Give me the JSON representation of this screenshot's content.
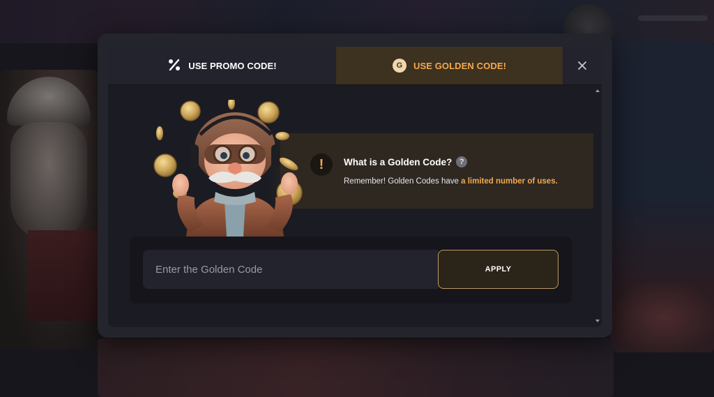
{
  "tabs": {
    "promo_label": "USE PROMO CODE!",
    "golden_label": "USE GOLDEN CODE!",
    "golden_icon_letter": "G",
    "active": "golden"
  },
  "info": {
    "title": "What is a Golden Code?",
    "help_symbol": "?",
    "warning_symbol": "!",
    "text_prefix": "Remember! Golden Codes have ",
    "text_highlight": "a limited number of uses."
  },
  "form": {
    "placeholder": "Enter the Golden Code",
    "value": "",
    "apply_label": "APPLY"
  },
  "icons": {
    "promo": "percent-icon",
    "golden": "golden-coin-icon",
    "close": "close-icon",
    "warning": "warning-icon",
    "help": "help-icon"
  },
  "colors": {
    "accent": "#f2a94e",
    "active_tab_bg": "#3d3120",
    "modal_bg": "#1b1b23",
    "button_border": "#bf9a62"
  }
}
